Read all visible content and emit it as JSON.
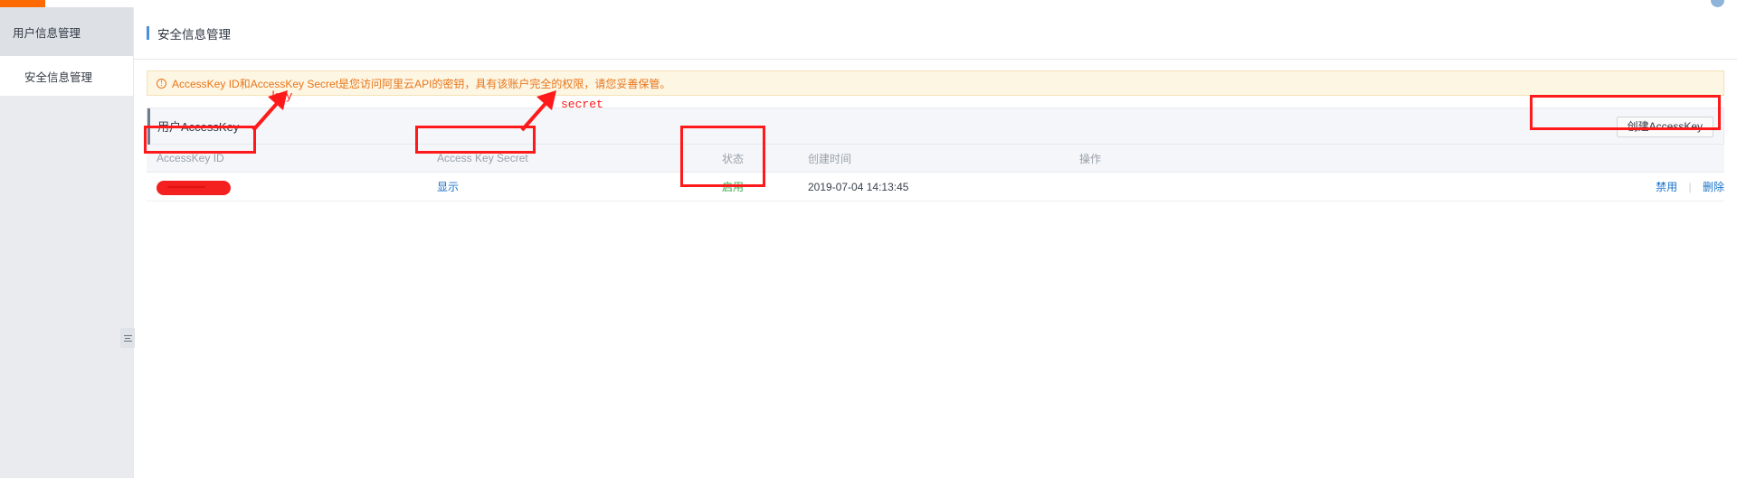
{
  "topbar": {
    "logo_text": "",
    "avatar_name": "user-avatar"
  },
  "sidebar": {
    "group_title": "用户信息管理",
    "items": [
      {
        "label": "安全信息管理",
        "active": true
      }
    ]
  },
  "page": {
    "title": "安全信息管理"
  },
  "alert": {
    "icon": "exclamation-circle-icon",
    "icon_glyph": "!",
    "text": "AccessKey ID和AccessKey Secret是您访问阿里云API的密钥，具有该账户完全的权限，请您妥善保管。",
    "color": "#e8761b",
    "background": "#fdf6e3"
  },
  "panel": {
    "title": "用户AccessKey",
    "create_button": "创建AccessKey"
  },
  "table": {
    "headers": [
      "AccessKey ID",
      "Access Key Secret",
      "状态",
      "创建时间",
      "操作"
    ],
    "rows": [
      {
        "access_key_id": "",
        "access_key_id_redacted": true,
        "secret_link": "显示",
        "status": "启用",
        "status_color": "#39a84a",
        "created_at": "2019-07-04 14:13:45",
        "action_disable": "禁用",
        "action_separator": "|",
        "action_delete": "删除"
      }
    ]
  },
  "annotations": {
    "color": "#fe1a1a",
    "labels": [
      {
        "text": "key"
      },
      {
        "text": "secret"
      }
    ]
  },
  "collapse_handle": {
    "name": "sidebar-collapse-handle"
  }
}
